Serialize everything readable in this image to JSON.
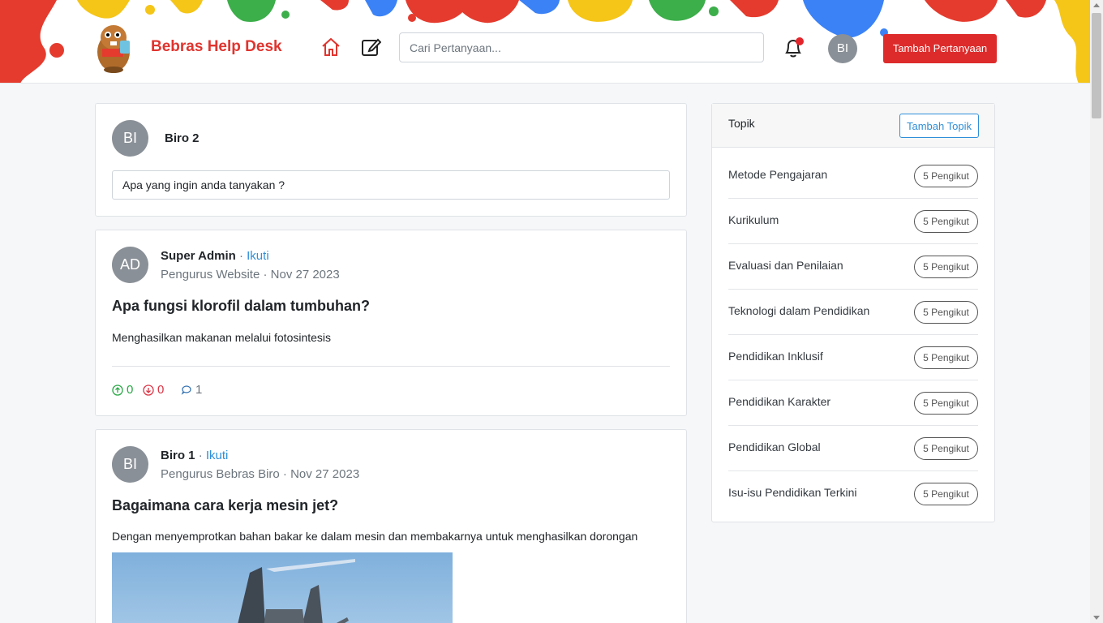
{
  "header": {
    "brand": "Bebras Help Desk",
    "search_placeholder": "Cari Pertanyaan...",
    "avatar_initials": "BI",
    "ask_button": "Tambah Pertanyaan"
  },
  "composer": {
    "avatar_initials": "BI",
    "user_name": "Biro 2",
    "placeholder": "Apa yang ingin anda tanyakan ?"
  },
  "posts": [
    {
      "avatar_initials": "AD",
      "author": "Super Admin",
      "separator": "·",
      "follow": "Ikuti",
      "role": "Pengurus Website",
      "date": "Nov 27 2023",
      "title": "Apa fungsi klorofil dalam tumbuhan?",
      "body": "Menghasilkan makanan melalui fotosintesis",
      "upvotes": "0",
      "downvotes": "0",
      "comments": "1"
    },
    {
      "avatar_initials": "BI",
      "author": "Biro 1",
      "separator": "·",
      "follow": "Ikuti",
      "role": "Pengurus Bebras Biro",
      "date": "Nov 27 2023",
      "title": "Bagaimana cara kerja mesin jet?",
      "body": "Dengan menyemprotkan bahan bakar ke dalam mesin dan membakarnya untuk menghasilkan dorongan"
    }
  ],
  "sidebar": {
    "title": "Topik",
    "add_button": "Tambah Topik",
    "topics": [
      {
        "name": "Metode Pengajaran",
        "followers": "5 Pengikut"
      },
      {
        "name": "Kurikulum",
        "followers": "5 Pengikut"
      },
      {
        "name": "Evaluasi dan Penilaian",
        "followers": "5 Pengikut"
      },
      {
        "name": "Teknologi dalam Pendidikan",
        "followers": "5 Pengikut"
      },
      {
        "name": "Pendidikan Inklusif",
        "followers": "5 Pengikut"
      },
      {
        "name": "Pendidikan Karakter",
        "followers": "5 Pengikut"
      },
      {
        "name": "Pendidikan Global",
        "followers": "5 Pengikut"
      },
      {
        "name": "Isu-isu Pendidikan Terkini",
        "followers": "5 Pengikut"
      }
    ]
  },
  "colors": {
    "brand": "#e0342e",
    "primary_button": "#dd2b2b",
    "link": "#2f8fd8",
    "upvote": "#28a745",
    "downvote": "#dc3545"
  }
}
